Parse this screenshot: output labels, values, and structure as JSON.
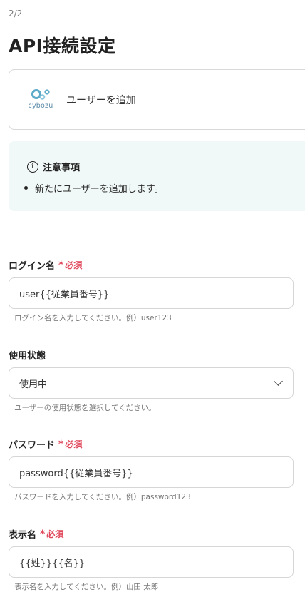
{
  "header": {
    "step": "2/2",
    "title": "API接続設定"
  },
  "app": {
    "logo_text": "cybozu",
    "action": "ユーザーを追加"
  },
  "notice": {
    "title": "注意事項",
    "items": [
      "新たにユーザーを追加します。"
    ]
  },
  "required_label": "必須",
  "fields": {
    "login": {
      "label": "ログイン名",
      "value": "user{{従業員番号}}",
      "hint": "ログイン名を入力してください。例）user123"
    },
    "status": {
      "label": "使用状態",
      "value": "使用中",
      "hint": "ユーザーの使用状態を選択してください。"
    },
    "password": {
      "label": "パスワード",
      "value": "password{{従業員番号}}",
      "hint": "パスワードを入力してください。例）password123"
    },
    "display_name": {
      "label": "表示名",
      "value": "{{姓}}{{名}}",
      "hint": "表示名を入力してください。例）山田 太郎"
    }
  },
  "colors": {
    "required": "#e0475a",
    "notice_bg": "#f1f9f8",
    "logo": "#5aaac8"
  }
}
